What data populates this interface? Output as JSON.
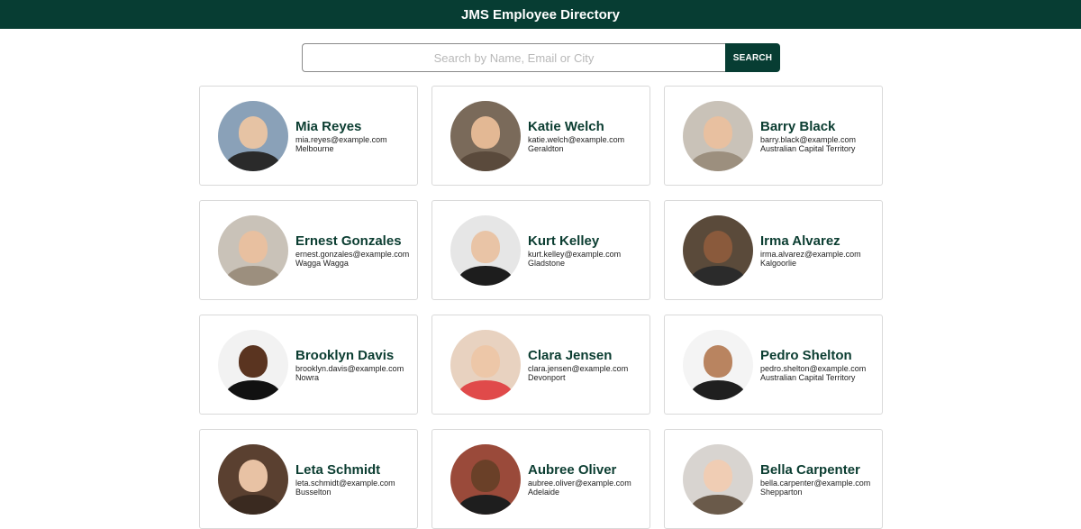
{
  "header": {
    "title": "JMS Employee Directory"
  },
  "search": {
    "placeholder": "Search by Name, Email or City",
    "value": "",
    "button_label": "SEARCH"
  },
  "employees": [
    {
      "name": "Mia Reyes",
      "email": "mia.reyes@example.com",
      "city": "Melbourne",
      "bg": "#8aa1b8",
      "skin": "#e6c3a4",
      "shirt": "#2a2a2a"
    },
    {
      "name": "Katie Welch",
      "email": "katie.welch@example.com",
      "city": "Geraldton",
      "bg": "#7a6a5a",
      "skin": "#e3b894",
      "shirt": "#5a4a3c"
    },
    {
      "name": "Barry Black",
      "email": "barry.black@example.com",
      "city": "Australian Capital Territory",
      "bg": "#c9c2b8",
      "skin": "#e8c0a0",
      "shirt": "#9c8f7e"
    },
    {
      "name": "Ernest Gonzales",
      "email": "ernest.gonzales@example.com",
      "city": "Wagga Wagga",
      "bg": "#c9c2b8",
      "skin": "#e8c0a0",
      "shirt": "#9c8f7e"
    },
    {
      "name": "Kurt Kelley",
      "email": "kurt.kelley@example.com",
      "city": "Gladstone",
      "bg": "#e6e6e6",
      "skin": "#e9c4a6",
      "shirt": "#1d1d1d"
    },
    {
      "name": "Irma Alvarez",
      "email": "irma.alvarez@example.com",
      "city": "Kalgoorlie",
      "bg": "#5a4a3a",
      "skin": "#8a5a3c",
      "shirt": "#2b2b2b"
    },
    {
      "name": "Brooklyn Davis",
      "email": "brooklyn.davis@example.com",
      "city": "Nowra",
      "bg": "#f2f2f2",
      "skin": "#5a3420",
      "shirt": "#111111"
    },
    {
      "name": "Clara Jensen",
      "email": "clara.jensen@example.com",
      "city": "Devonport",
      "bg": "#e8d2c0",
      "skin": "#edc7a8",
      "shirt": "#e04a4a"
    },
    {
      "name": "Pedro Shelton",
      "email": "pedro.shelton@example.com",
      "city": "Australian Capital Territory",
      "bg": "#f4f4f4",
      "skin": "#b98460",
      "shirt": "#1f1f1f"
    },
    {
      "name": "Leta Schmidt",
      "email": "leta.schmidt@example.com",
      "city": "Busselton",
      "bg": "#5a4030",
      "skin": "#e8c2a4",
      "shirt": "#3a2a20"
    },
    {
      "name": "Aubree Oliver",
      "email": "aubree.oliver@example.com",
      "city": "Adelaide",
      "bg": "#9a4a3a",
      "skin": "#6a4028",
      "shirt": "#1e1e1e"
    },
    {
      "name": "Bella Carpenter",
      "email": "bella.carpenter@example.com",
      "city": "Shepparton",
      "bg": "#d8d4d0",
      "skin": "#f0cdb4",
      "shirt": "#6a5a4a"
    }
  ]
}
